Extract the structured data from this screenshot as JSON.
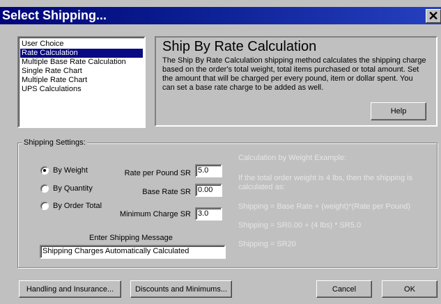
{
  "window": {
    "title": "Select Shipping..."
  },
  "methods": {
    "items": [
      "User Choice",
      "Rate Calculation",
      "Multiple Base Rate Calculation",
      "Single Rate Chart",
      "Multiple Rate Chart",
      "UPS Calculations"
    ],
    "selected": "Rate Calculation"
  },
  "description": {
    "title": "Ship By Rate Calculation",
    "text": "The Ship By Rate Calculation shipping method calculates the shipping charge based on the order's total weight, total items purchased or total amount.  Set the amount that will be charged per every pound, item or dollar spent.  You can set a base rate charge to be added as well.",
    "help_label": "Help"
  },
  "settings": {
    "legend": "Shipping Settings:",
    "radios": [
      {
        "label": "By Weight",
        "checked": true
      },
      {
        "label": "By Quantity",
        "checked": false
      },
      {
        "label": "By Order Total",
        "checked": false
      }
    ],
    "rate_label": "Rate per Pound SR",
    "rate_value": "5.0",
    "base_label": "Base Rate SR",
    "base_value": "0.00",
    "min_label": "Minimum Charge SR",
    "min_value": "3.0",
    "message_label": "Enter Shipping Message",
    "message_value": "Shipping Charges Automatically Calculated"
  },
  "example": {
    "heading": "Calculation by Weight Example:",
    "line1": "If the total order weight is 4 lbs, then the shipping is",
    "line2": "calculated as:",
    "formula": "Shipping = Base Rate + (weight)*(Rate per Pound)",
    "substituted": "Shipping = SR0.00 + (4 lbs) * SR5.0",
    "result": "Shipping = SR20"
  },
  "buttons": {
    "handling": "Handling and Insurance...",
    "discounts": "Discounts and Minimums...",
    "cancel": "Cancel",
    "ok": "OK"
  }
}
